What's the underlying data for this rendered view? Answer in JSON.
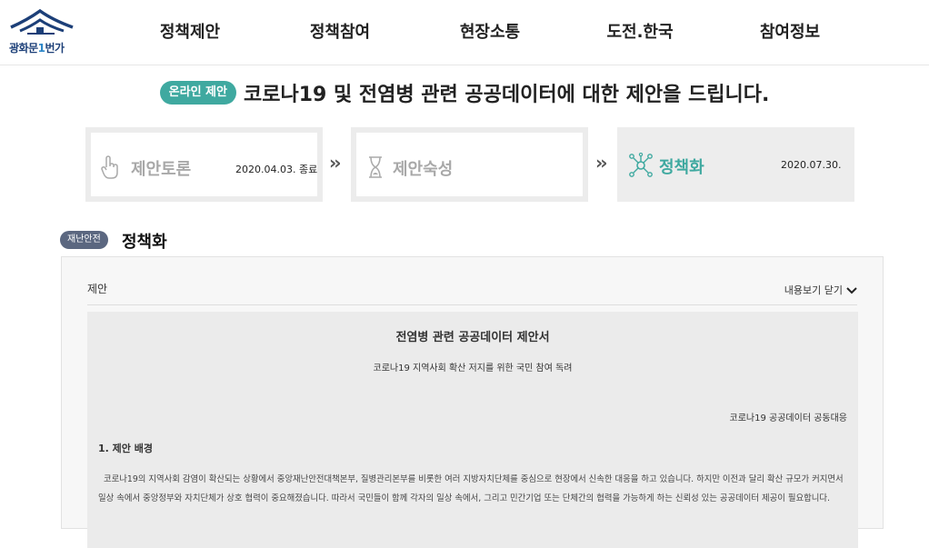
{
  "header": {
    "logo_text_a": "광화문",
    "logo_text_num": "1",
    "logo_text_b": "번가",
    "nav": [
      "정책제안",
      "정책참여",
      "현장소통",
      "도전.한국",
      "참여정보"
    ]
  },
  "title": {
    "badge": "온라인 제안",
    "text": "코로나19 및 전염병 관련 공공데이터에 대한 제안을 드립니다."
  },
  "steps": [
    {
      "label": "제안토론",
      "date": "2020.04.03. 종료",
      "icon": "hand-pointer-icon"
    },
    {
      "label": "제안숙성",
      "date": "",
      "icon": "hourglass-icon"
    },
    {
      "label": "정책화",
      "date": "2020.07.30.",
      "icon": "network-icon"
    }
  ],
  "category": {
    "badge": "재난안전",
    "title": "정책화"
  },
  "panel": {
    "head": "제안",
    "toggle": "내용보기 닫기",
    "doc_title": "전염병 관련 공공데이터 제안서",
    "doc_subtitle": "코로나19 지역사회 확산 저지를 위한 국민 참여 독려",
    "doc_org": "코로나19 공공데이터 공동대응",
    "section_heading": "1. 제안 배경",
    "paragraph": "코로나19의 지역사회 감염이 확산되는 상황에서 중앙재난안전대책본부, 질병관리본부를 비롯한 여러 지방자치단체를 중심으로 현장에서 신속한 대응을 하고 있습니다. 하지만 이전과 달리 확산 규모가 커지면서 일상 속에서 중앙정부와 자치단체가 상호 협력이 중요해졌습니다. 따라서 국민들이 함께 각자의 일상 속에서, 그리고 민간기업 또는 단체간의 협력을 가능하게 하는 신뢰성 있는 공공데이터 제공이 필요합니다."
  },
  "colors": {
    "accent": "#3fa9a0",
    "category_badge": "#5b6780",
    "logo_navy": "#1c3f78"
  }
}
